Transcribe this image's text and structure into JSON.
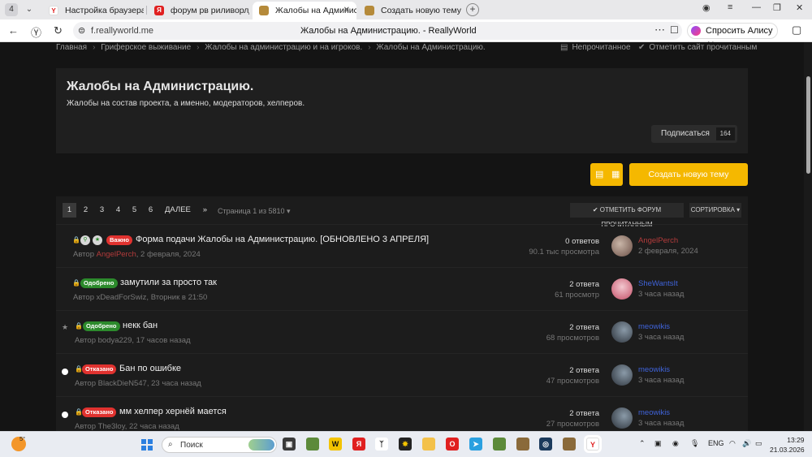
{
  "browser": {
    "tab_count": "4",
    "tabs": [
      {
        "title": "Настройка браузера"
      },
      {
        "title": "форум рв риливорлд — Я"
      },
      {
        "title": "Жалобы на Администра"
      },
      {
        "title": "Создать новую тему - Rea"
      }
    ],
    "url": "f.reallyworld.me",
    "page_title": "Жалобы на Администрацию. - ReallyWorld",
    "alisa_label": "Спросить Алису AI"
  },
  "breadcrumb": {
    "items": [
      "Главная",
      "Гриферское выживание",
      "Жалобы на администрацию и на игроков.",
      "Жалобы на Администрацию."
    ],
    "unread": "Непрочитанное",
    "mark_site_read": "Отметить сайт прочитанным"
  },
  "forum": {
    "title": "Жалобы на Администрацию.",
    "description": "Жалобы на состав проекта, а именно, модераторов, хелперов.",
    "subscribe_label": "Подписаться",
    "subscribe_count": "164",
    "create_topic_label": "Создать новую тему"
  },
  "pagination": {
    "pages": [
      "1",
      "2",
      "3",
      "4",
      "5",
      "6"
    ],
    "next_label": "ДАЛЕЕ",
    "last_label": "»",
    "info": "Страница 1 из 5810 ▾",
    "mark_forum_read": "✔ ОТМЕТИТЬ ФОРУМ ПРОЧИТАННЫМ",
    "sort_label": "СОРТИРОВКА ▾"
  },
  "topics": [
    {
      "badge": "Важно",
      "title": "Форма подачи Жалобы на Администрацию. [ОБНОВЛЕНО 3 АПРЕЛЯ]",
      "author_prefix": "Автор",
      "author": "AngelPerch",
      "date": ", 2 февраля, 2024",
      "replies": "0 ответов",
      "views": "90.1 тыс просмотра",
      "last_user": "AngelPerch",
      "last_time": "2 февраля, 2024"
    },
    {
      "badge": "Одобрено",
      "title": "замутили за просто так",
      "author_prefix": "Автор",
      "author": "xDeadForSwiz",
      "date": ", Вторник в 21:50",
      "replies": "2 ответа",
      "views": "61 просмотр",
      "last_user": "SheWantsIt",
      "last_time": "3 часа назад"
    },
    {
      "badge": "Одобрено",
      "title": "некк бан",
      "author_prefix": "Автор",
      "author": "bodya229",
      "date": ", 17 часов назад",
      "replies": "2 ответа",
      "views": "68 просмотров",
      "last_user": "meowikis",
      "last_time": "3 часа назад"
    },
    {
      "badge": "Отказано",
      "title": "Бан по ошибке",
      "author_prefix": "Автор",
      "author": "BlackDieN547",
      "date": ", 23 часа назад",
      "replies": "2 ответа",
      "views": "47 просмотров",
      "last_user": "meowikis",
      "last_time": "3 часа назад"
    },
    {
      "badge": "Отказано",
      "title": "мм хелпер хернёй мается",
      "author_prefix": "Автор",
      "author": "The3loy",
      "date": ", 22 часа назад",
      "replies": "2 ответа",
      "views": "27 просмотров",
      "last_user": "meowikis",
      "last_time": "3 часа назад"
    }
  ],
  "taskbar": {
    "temperature": "5°",
    "search_placeholder": "Поиск",
    "lang": "ENG",
    "time": "13:29",
    "date": "21.03.2026"
  },
  "colors": {
    "accent": "#f5b800",
    "approved": "#2c8a2c",
    "rejected": "#e0322f",
    "user_link": "#3f63d9"
  }
}
